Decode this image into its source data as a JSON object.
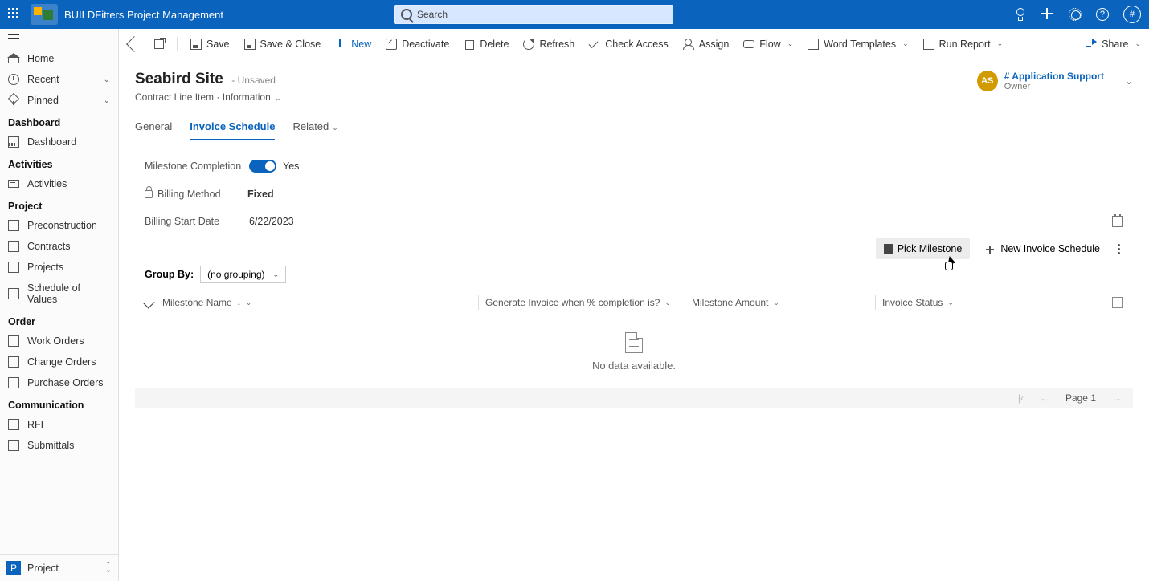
{
  "topbar": {
    "app_title": "BUILDFitters Project Management",
    "search_placeholder": "Search"
  },
  "top_icons": {
    "question": "?",
    "avatar": "#"
  },
  "sidebar": {
    "home": "Home",
    "recent": "Recent",
    "pinned": "Pinned",
    "s_dashboard": "Dashboard",
    "dashboard": "Dashboard",
    "s_activities": "Activities",
    "activities": "Activities",
    "s_project": "Project",
    "preconstruction": "Preconstruction",
    "contracts": "Contracts",
    "projects": "Projects",
    "sov": "Schedule of Values",
    "s_order": "Order",
    "work_orders": "Work Orders",
    "change_orders": "Change Orders",
    "purchase_orders": "Purchase Orders",
    "s_comm": "Communication",
    "rfi": "RFI",
    "submittals": "Submittals",
    "footer_label": "Project",
    "footer_badge": "P"
  },
  "commandbar": {
    "save": "Save",
    "save_close": "Save & Close",
    "new": "New",
    "deactivate": "Deactivate",
    "delete": "Delete",
    "refresh": "Refresh",
    "check_access": "Check Access",
    "assign": "Assign",
    "flow": "Flow",
    "word_templates": "Word Templates",
    "run_report": "Run Report",
    "share": "Share"
  },
  "record": {
    "title": "Seabird Site",
    "status": "- Unsaved",
    "entity": "Contract Line Item",
    "form": "Information",
    "owner_initials": "AS",
    "owner_name": "# Application Support",
    "owner_role": "Owner"
  },
  "tabs": {
    "general": "General",
    "invoice_schedule": "Invoice Schedule",
    "related": "Related"
  },
  "form": {
    "milestone_completion_label": "Milestone Completion",
    "milestone_completion_value": "Yes",
    "billing_method_label": "Billing Method",
    "billing_method_value": "Fixed",
    "billing_start_label": "Billing Start Date",
    "billing_start_value": "6/22/2023"
  },
  "grid_toolbar": {
    "group_by": "Group By:",
    "group_by_value": "(no grouping)",
    "pick_milestone": "Pick Milestone",
    "new_invoice_schedule": "New Invoice Schedule"
  },
  "grid_columns": {
    "milestone_name": "Milestone Name",
    "gen_invoice": "Generate Invoice when % completion is?",
    "milestone_amount": "Milestone Amount",
    "invoice_status": "Invoice Status"
  },
  "grid_empty": "No data available.",
  "pager": {
    "page": "Page 1"
  }
}
